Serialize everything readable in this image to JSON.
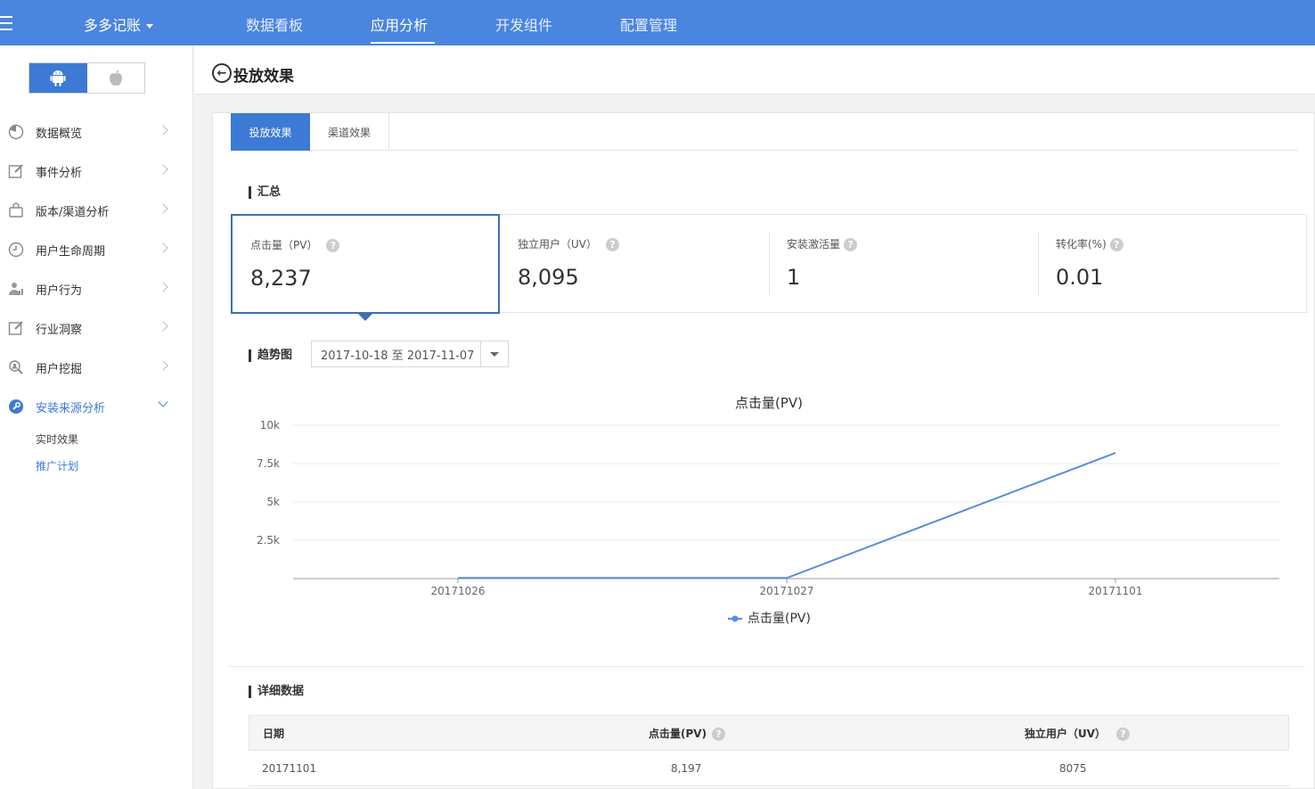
{
  "topnav": {
    "brand": "多多记账",
    "items": [
      {
        "label": "数据看板"
      },
      {
        "label": "应用分析",
        "active": true
      },
      {
        "label": "开发组件"
      },
      {
        "label": "配置管理"
      }
    ]
  },
  "sidebar": {
    "os_toggle": {
      "active": "android-icon",
      "inactive": "apple-icon"
    },
    "items": [
      {
        "label": "数据概览",
        "icon": "pie-chart-icon"
      },
      {
        "label": "事件分析",
        "icon": "edit-icon"
      },
      {
        "label": "版本/渠道分析",
        "icon": "bag-icon"
      },
      {
        "label": "用户生命周期",
        "icon": "clock-icon"
      },
      {
        "label": "用户行为",
        "icon": "user-chart-icon"
      },
      {
        "label": "行业洞察",
        "icon": "edit-icon"
      },
      {
        "label": "用户挖掘",
        "icon": "search-user-icon"
      },
      {
        "label": "安装来源分析",
        "icon": "wrench-icon",
        "open": true
      }
    ],
    "subitems": [
      {
        "label": "实时效果"
      },
      {
        "label": "推广计划",
        "active": true
      }
    ]
  },
  "page": {
    "title": "投放效果"
  },
  "tabs": [
    {
      "label": "投放效果",
      "active": true
    },
    {
      "label": "渠道效果"
    }
  ],
  "summary": {
    "title": "汇总",
    "kpis": [
      {
        "label": "点击量（PV）",
        "value": "8,237"
      },
      {
        "label": "独立用户（UV）",
        "value": "8,095"
      },
      {
        "label": "安装激活量",
        "value": "1"
      },
      {
        "label": "转化率(%)",
        "value": "0.01"
      }
    ]
  },
  "trend": {
    "title": "趋势图",
    "date_range": "2017-10-18 至 2017-11-07"
  },
  "chart_data": {
    "type": "line",
    "title": "点击量(PV)",
    "x": [
      "20171026",
      "20171027",
      "20171101"
    ],
    "series": [
      {
        "name": "点击量(PV)",
        "values": [
          40,
          40,
          8197
        ]
      }
    ],
    "y_ticks": [
      "2.5k",
      "5k",
      "7.5k",
      "10k"
    ],
    "ylim": [
      0,
      10000
    ],
    "grid": true,
    "legend": "bottom",
    "color": "#5b8ed9"
  },
  "detail": {
    "title": "详细数据",
    "columns": [
      "日期",
      "点击量(PV)",
      "独立用户（UV）"
    ],
    "rows": [
      [
        "20171101",
        "8,197",
        "8075"
      ]
    ]
  },
  "colors": {
    "nav": "#4a85e0",
    "accent": "#3d7ad6"
  }
}
